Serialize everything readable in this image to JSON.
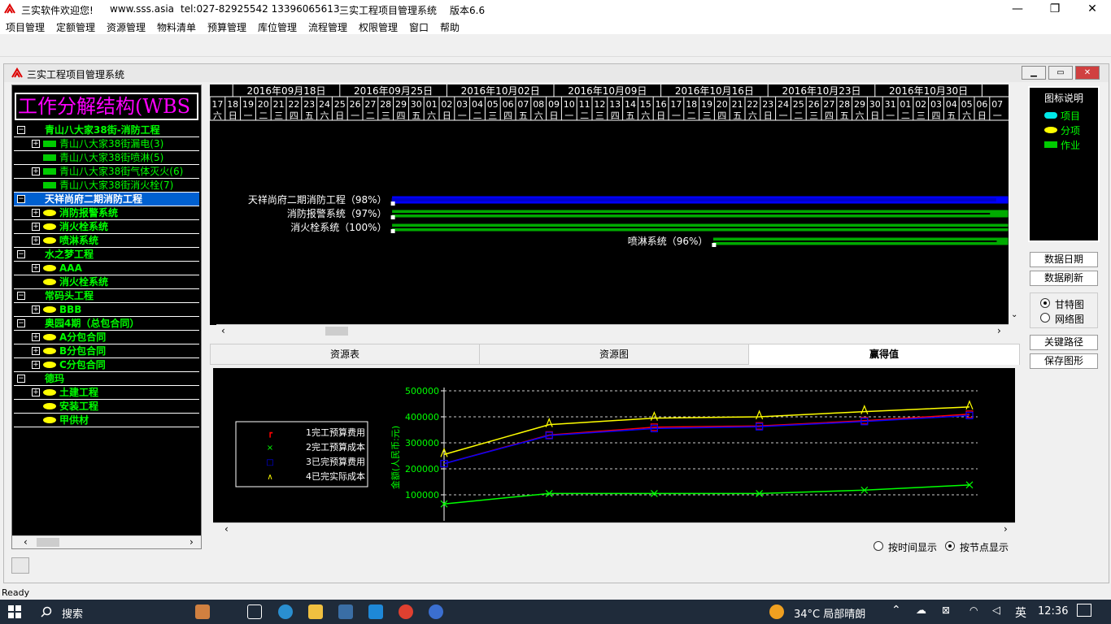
{
  "titlebar": {
    "welcome": "三实软件欢迎您!",
    "website": "www.sss.asia",
    "tel": "tel:027-82925542 13396065613",
    "app_name": "三实工程项目管理系统",
    "version": "版本6.6"
  },
  "menu": [
    "项目管理",
    "定额管理",
    "资源管理",
    "物料清单",
    "预算管理",
    "库位管理",
    "流程管理",
    "权限管理",
    "窗口",
    "帮助"
  ],
  "child_window": {
    "title": "三实工程项目管理系统"
  },
  "wbs": {
    "header": "工作分解结构(WBS",
    "items": [
      {
        "label": "青山八大家38街-消防工程",
        "type": "project",
        "level": 0,
        "toggle": "−",
        "bold": true
      },
      {
        "label": "青山八大家38街漏电(3)",
        "type": "work",
        "level": 1,
        "toggle": "+"
      },
      {
        "label": "青山八大家38街喷淋(5)",
        "type": "work",
        "level": 1,
        "toggle": ""
      },
      {
        "label": "青山八大家38街气体灭火(6)",
        "type": "work",
        "level": 1,
        "toggle": "+"
      },
      {
        "label": "青山八大家38街消火栓(7)",
        "type": "work",
        "level": 1,
        "toggle": ""
      },
      {
        "label": "天祥尚府二期消防工程",
        "type": "project",
        "level": 0,
        "toggle": "−",
        "bold": true,
        "selected": true
      },
      {
        "label": "消防报警系统",
        "type": "part",
        "level": 1,
        "toggle": "+",
        "bold": true
      },
      {
        "label": "消火栓系统",
        "type": "part",
        "level": 1,
        "toggle": "+",
        "bold": true
      },
      {
        "label": "喷淋系统",
        "type": "part",
        "level": 1,
        "toggle": "+",
        "bold": true
      },
      {
        "label": "水之梦工程",
        "type": "project",
        "level": 0,
        "toggle": "−",
        "bold": true
      },
      {
        "label": "AAA",
        "type": "part",
        "level": 1,
        "toggle": "+",
        "bold": true
      },
      {
        "label": "消火栓系统",
        "type": "part",
        "level": 1,
        "toggle": "",
        "bold": true
      },
      {
        "label": "常码头工程",
        "type": "project",
        "level": 0,
        "toggle": "−",
        "bold": true
      },
      {
        "label": "BBB",
        "type": "part",
        "level": 1,
        "toggle": "+",
        "bold": true
      },
      {
        "label": "奥园4期（总包合同）",
        "type": "project",
        "level": 0,
        "toggle": "−",
        "bold": true
      },
      {
        "label": "A分包合同",
        "type": "part",
        "level": 1,
        "toggle": "+",
        "bold": true
      },
      {
        "label": "B分包合同",
        "type": "part",
        "level": 1,
        "toggle": "+",
        "bold": true
      },
      {
        "label": "C分包合同",
        "type": "part",
        "level": 1,
        "toggle": "+",
        "bold": true
      },
      {
        "label": "德玛",
        "type": "project",
        "level": 0,
        "toggle": "−",
        "bold": true
      },
      {
        "label": "土建工程",
        "type": "part",
        "level": 1,
        "toggle": "+",
        "bold": true
      },
      {
        "label": "安装工程",
        "type": "part",
        "level": 1,
        "toggle": "",
        "bold": true
      },
      {
        "label": "甲供材",
        "type": "part",
        "level": 1,
        "toggle": "",
        "bold": true
      }
    ]
  },
  "gantt": {
    "weeks": [
      "2016年09月18日",
      "2016年09月25日",
      "2016年10月02日",
      "2016年10月09日",
      "2016年10月16日",
      "2016年10月23日",
      "2016年10月30日",
      "201"
    ],
    "days": [
      "17",
      "18",
      "19",
      "20",
      "21",
      "22",
      "23",
      "24",
      "25",
      "26",
      "27",
      "28",
      "29",
      "30",
      "01",
      "02",
      "03",
      "04",
      "05",
      "06",
      "07",
      "08",
      "09",
      "10",
      "11",
      "12",
      "13",
      "14",
      "15",
      "16",
      "17",
      "18",
      "19",
      "20",
      "21",
      "22",
      "23",
      "24",
      "25",
      "26",
      "27",
      "28",
      "29",
      "30",
      "31",
      "01",
      "02",
      "03",
      "04",
      "05",
      "06",
      "07"
    ],
    "weekdays": [
      "六",
      "日",
      "一",
      "二",
      "三",
      "四",
      "五",
      "六",
      "日",
      "一",
      "二",
      "三",
      "四",
      "五",
      "六",
      "日",
      "一",
      "二",
      "三",
      "四",
      "五",
      "六",
      "日",
      "一",
      "二",
      "三",
      "四",
      "五",
      "六",
      "日",
      "一",
      "二",
      "三",
      "四",
      "五",
      "六",
      "日",
      "一",
      "二",
      "三",
      "四",
      "五",
      "六",
      "日",
      "一",
      "二",
      "三",
      "四",
      "五",
      "六",
      "日",
      "一"
    ],
    "bars": [
      {
        "label": "天祥尚府二期消防工程（98%）",
        "type": "project",
        "start_day": 12,
        "progress": 0.98
      },
      {
        "label": "消防报警系统（97%）",
        "type": "work",
        "start_day": 12,
        "progress": 0.97
      },
      {
        "label": "消火栓系统（100%）",
        "type": "work",
        "start_day": 12,
        "progress": 1.0
      },
      {
        "label": "喷淋系统（96%）",
        "type": "work",
        "start_day": 33,
        "progress": 0.96
      }
    ]
  },
  "legend": {
    "title": "图标说明",
    "items": [
      {
        "label": "项目",
        "type": "project"
      },
      {
        "label": "分项",
        "type": "part"
      },
      {
        "label": "作业",
        "type": "work"
      }
    ]
  },
  "side_buttons": {
    "data_date": "数据日期",
    "data_refresh": "数据刷新",
    "gantt_radio": "甘特图",
    "network_radio": "网络图",
    "critical_path": "关键路径",
    "save_graph": "保存图形"
  },
  "tabs": [
    {
      "label": "资源表",
      "active": false
    },
    {
      "label": "资源图",
      "active": false
    },
    {
      "label": "赢得值",
      "active": true
    }
  ],
  "chart_data": {
    "type": "line",
    "ylabel": "金额(人民币:元)",
    "ylim": [
      0,
      500000
    ],
    "yticks": [
      "100000",
      "200000",
      "300000",
      "400000",
      "500000"
    ],
    "grid": true,
    "legend_position": "left",
    "series": [
      {
        "name": "1完工预算费用",
        "color": "#ff0000",
        "marker": "┏",
        "values": [
          220000,
          330000,
          360000,
          365000,
          385000,
          410000
        ]
      },
      {
        "name": "2完工预算成本",
        "color": "#00ff00",
        "marker": "×",
        "values": [
          65000,
          105000,
          105000,
          105000,
          118000,
          138000
        ]
      },
      {
        "name": "3已完预算费用",
        "color": "#0000ff",
        "marker": "□",
        "values": [
          220000,
          328000,
          355000,
          362000,
          382000,
          405000
        ]
      },
      {
        "name": "4已完实际成本",
        "color": "#ffff00",
        "marker": "∧",
        "values": [
          255000,
          370000,
          395000,
          400000,
          420000,
          438000
        ]
      }
    ]
  },
  "display_mode": {
    "by_time": "按时间显示",
    "by_node": "按节点显示",
    "selected": "by_node"
  },
  "status": "Ready",
  "taskbar": {
    "search": "搜索",
    "weather": "34°C 局部晴朗",
    "ime": "英",
    "time": "12:36"
  },
  "colors": {
    "project": "#0000ff",
    "work": "#00aa00",
    "accent": "#ff00ff"
  }
}
